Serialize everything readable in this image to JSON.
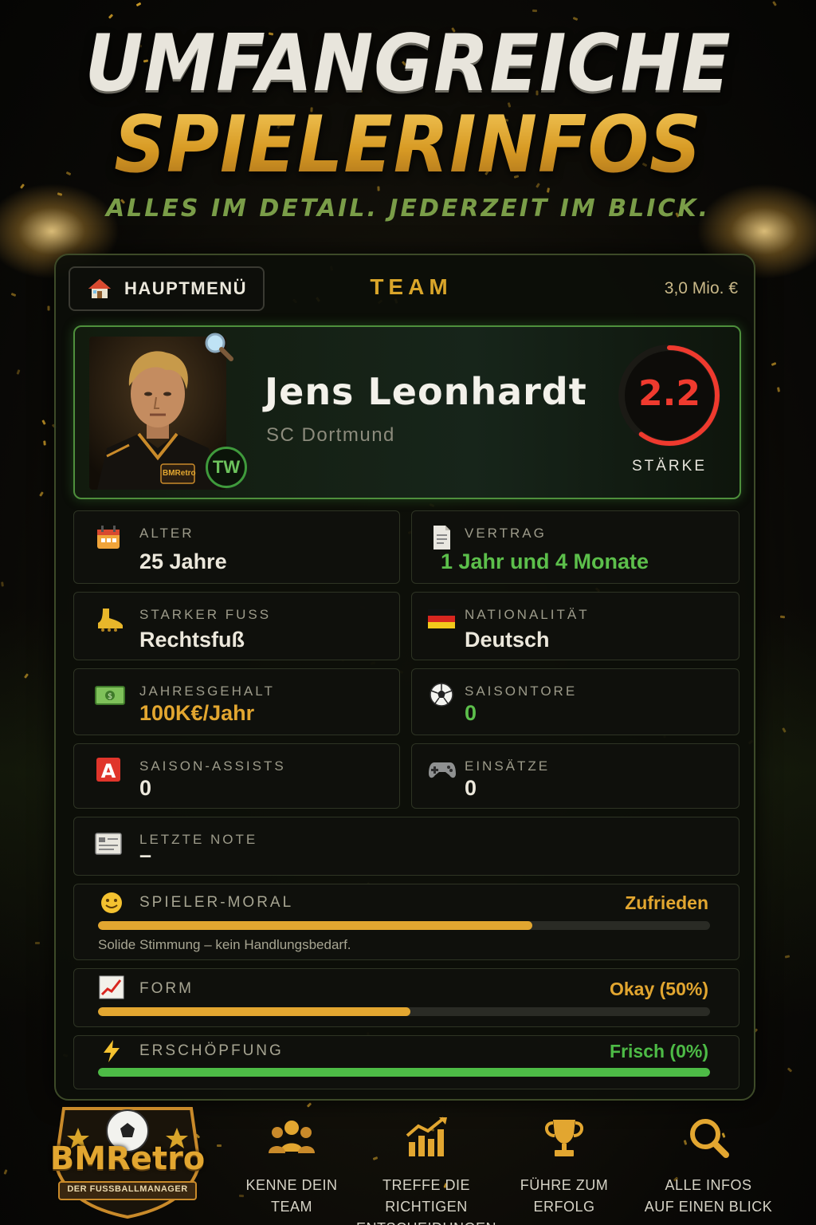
{
  "headline": {
    "line1": "UMFANGREICHE",
    "line2": "SPIELERINFOS",
    "tagline": "ALLES IM DETAIL. JEDERZEIT IM BLICK."
  },
  "topbar": {
    "home_label": "HAUPTMENÜ",
    "title": "TEAM",
    "budget": "3,0 Mio. €"
  },
  "player": {
    "name": "Jens Leonhardt",
    "club": "SC Dortmund",
    "position": "TW",
    "rating": "2.2",
    "rating_label": "STÄRKE",
    "rating_fraction": 0.6,
    "jersey_logo": "BMRetro"
  },
  "stats": {
    "age": {
      "label": "ALTER",
      "value": "25 Jahre",
      "icon": "calendar-icon"
    },
    "contract": {
      "label": "VERTRAG",
      "value": "1 Jahr und 4 Monate",
      "icon": "document-icon"
    },
    "foot": {
      "label": "STARKER FUSS",
      "value": "Rechtsfuß",
      "icon": "boot-icon"
    },
    "nationality": {
      "label": "NATIONALITÄT",
      "value": "Deutsch",
      "icon": "german-flag-icon"
    },
    "salary": {
      "label": "JAHRESGEHALT",
      "value": "100K€/Jahr",
      "icon": "banknote-icon"
    },
    "goals": {
      "label": "SAISONTORE",
      "value": "0",
      "icon": "football-icon"
    },
    "assists": {
      "label": "SAISON-ASSISTS",
      "value": "0",
      "icon": "letter-a-icon"
    },
    "appearances": {
      "label": "EINSÄTZE",
      "value": "0",
      "icon": "gamepad-icon"
    },
    "last_grade": {
      "label": "LETZTE NOTE",
      "value": "–",
      "icon": "report-card-icon"
    }
  },
  "bars": {
    "morale": {
      "label": "SPIELER-MORAL",
      "status": "Zufrieden",
      "note": "Solide Stimmung – kein Handlungsbedarf.",
      "level": 0.71,
      "color": "#e2a630",
      "icon": "smiley-icon"
    },
    "form": {
      "label": "FORM",
      "status": "Okay (50%)",
      "level": 0.51,
      "color": "#e2a630",
      "icon": "chart-up-icon"
    },
    "fatigue": {
      "label": "ERSCHÖPFUNG",
      "status": "Frisch (0%)",
      "level": 1.0,
      "color": "#4dbb46",
      "icon": "lightning-icon"
    }
  },
  "logo": {
    "name": "BMRetro",
    "subtitle": "DER FUSSBALLMANAGER"
  },
  "nav": [
    {
      "line1": "KENNE DEIN",
      "line2": "TEAM",
      "icon": "team-icon"
    },
    {
      "line1": "TREFFE DIE RICHTIGEN",
      "line2": "ENTSCHEIDUNGEN",
      "icon": "bar-chart-icon"
    },
    {
      "line1": "FÜHRE ZUM",
      "line2": "ERFOLG",
      "icon": "trophy-icon"
    },
    {
      "line1": "ALLE INFOS",
      "line2": "AUF EINEN BLICK",
      "icon": "search-icon"
    }
  ],
  "colors": {
    "gold": "#d9a52a",
    "green": "#5cbf4b",
    "red": "#ef3a2e",
    "panel": "#0c0e09"
  }
}
